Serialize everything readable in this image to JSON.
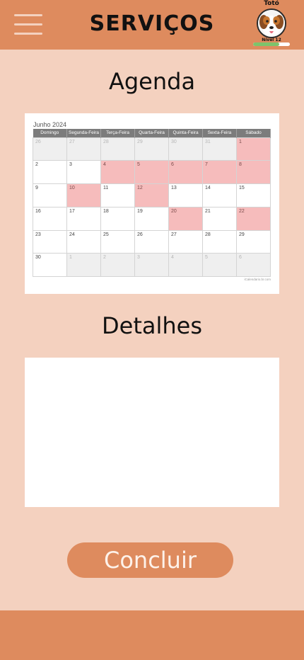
{
  "header": {
    "title": "SERVIÇOS",
    "menu_icon": "hamburger-menu-icon",
    "pet": {
      "name": "Totó",
      "level_label": "Nível 12",
      "level_progress": 0.72,
      "avatar_icon": "dog-avatar"
    }
  },
  "agenda": {
    "title": "Agenda",
    "calendar": {
      "month_label": "Junho 2024",
      "weekdays": [
        "Domingo",
        "Segunda-Feira",
        "Terça-Feira",
        "Quarta-Feira",
        "Quinta-Feira",
        "Sexta-Feira",
        "Sábado"
      ],
      "weeks": [
        [
          {
            "d": "26",
            "other": true
          },
          {
            "d": "27",
            "other": true
          },
          {
            "d": "28",
            "other": true
          },
          {
            "d": "29",
            "other": true
          },
          {
            "d": "30",
            "other": true
          },
          {
            "d": "31",
            "other": true
          },
          {
            "d": "1",
            "hl": true
          }
        ],
        [
          {
            "d": "2"
          },
          {
            "d": "3"
          },
          {
            "d": "4",
            "hl": true
          },
          {
            "d": "5",
            "hl": true
          },
          {
            "d": "6",
            "hl": true
          },
          {
            "d": "7",
            "hl": true
          },
          {
            "d": "8",
            "hl": true
          }
        ],
        [
          {
            "d": "9"
          },
          {
            "d": "10",
            "hl": true
          },
          {
            "d": "11"
          },
          {
            "d": "12",
            "hl": true
          },
          {
            "d": "13"
          },
          {
            "d": "14"
          },
          {
            "d": "15"
          }
        ],
        [
          {
            "d": "16"
          },
          {
            "d": "17"
          },
          {
            "d": "18"
          },
          {
            "d": "19"
          },
          {
            "d": "20",
            "hl": true
          },
          {
            "d": "21"
          },
          {
            "d": "22",
            "hl": true
          }
        ],
        [
          {
            "d": "23"
          },
          {
            "d": "24"
          },
          {
            "d": "25"
          },
          {
            "d": "26"
          },
          {
            "d": "27"
          },
          {
            "d": "28"
          },
          {
            "d": "29"
          }
        ],
        [
          {
            "d": "30"
          },
          {
            "d": "1",
            "other": true
          },
          {
            "d": "2",
            "other": true
          },
          {
            "d": "3",
            "other": true
          },
          {
            "d": "4",
            "other": true
          },
          {
            "d": "5",
            "other": true
          },
          {
            "d": "6",
            "other": true
          }
        ]
      ],
      "credit": "iCalendario.br.com",
      "highlight_color": "#f6bcbc"
    }
  },
  "details": {
    "title": "Detalhes",
    "value": "",
    "placeholder": ""
  },
  "actions": {
    "submit_label": "Concluir"
  },
  "colors": {
    "primary": "#de8b5e",
    "background": "#f4d1bf"
  }
}
